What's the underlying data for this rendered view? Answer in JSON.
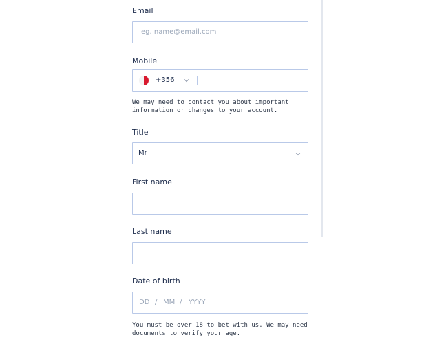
{
  "email": {
    "label": "Email",
    "placeholder": "eg. name@email.com"
  },
  "mobile": {
    "label": "Mobile",
    "country_code": "+356",
    "flag": "malta-flag-icon",
    "helper": "We may need to contact you about important information or changes to your account."
  },
  "title": {
    "label": "Title",
    "value": "Mr"
  },
  "first_name": {
    "label": "First name"
  },
  "last_name": {
    "label": "Last name"
  },
  "dob": {
    "label": "Date of birth",
    "day": "DD",
    "month": "MM",
    "year": "YYYY",
    "sep": "/",
    "helper": "You must be over 18 to bet with us. We may need documents to verify your age."
  },
  "colors": {
    "border": "#b9c9e8",
    "text": "#1b2a4a",
    "placeholder": "#9aa6b8",
    "flag_red": "#d8192e"
  }
}
